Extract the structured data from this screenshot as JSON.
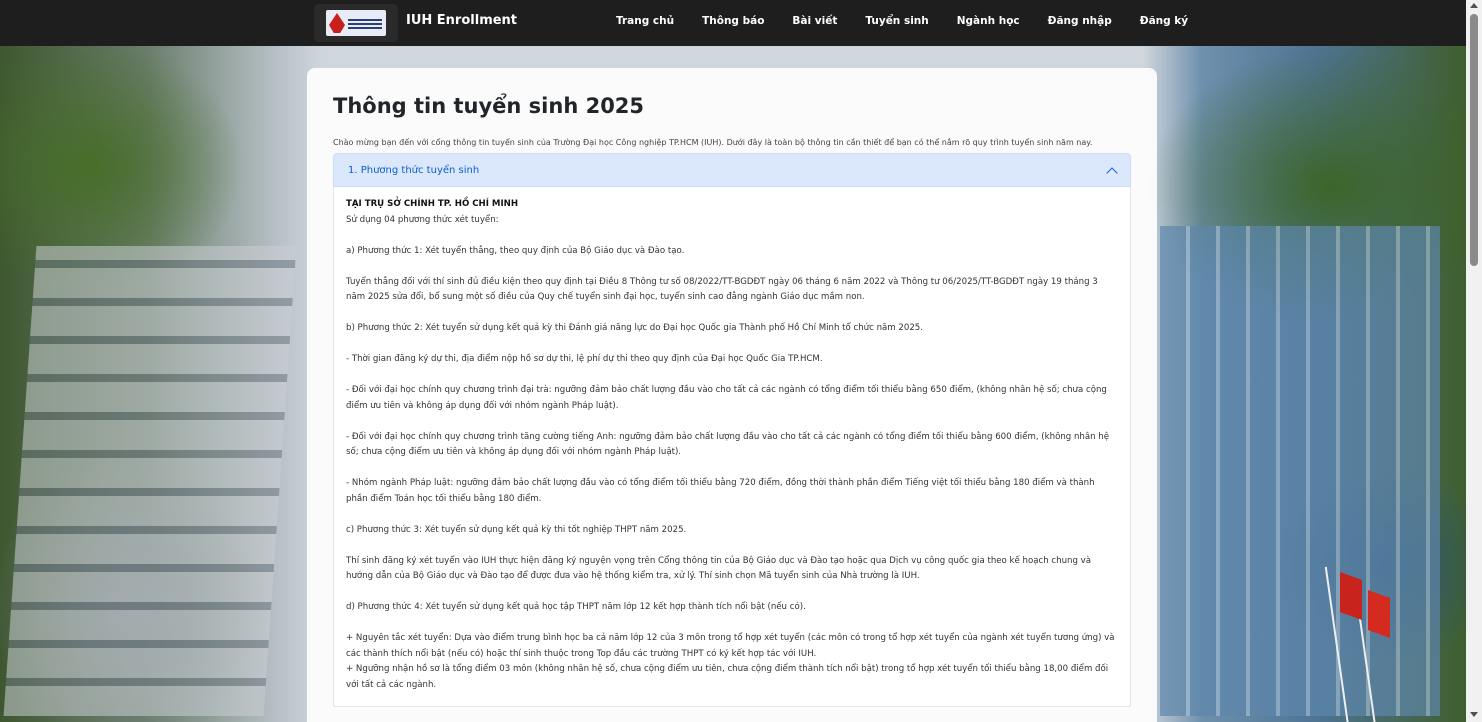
{
  "navbar": {
    "brand": "IUH Enrollment",
    "links": [
      "Trang chủ",
      "Thông báo",
      "Bài viết",
      "Tuyển sinh",
      "Ngành học",
      "Đăng nhập",
      "Đăng ký"
    ]
  },
  "page": {
    "title": "Thông tin tuyển sinh 2025",
    "intro": "Chào mừng bạn đến với cổng thông tin tuyển sinh của Trường Đại học Công nghiệp TP.HCM (IUH). Dưới đây là toàn bộ thông tin cần thiết để bạn có thể nắm rõ quy trình tuyển sinh năm nay."
  },
  "accordion": {
    "header": "1. Phương thức tuyển sinh",
    "paragraphs": [
      "TẠI TRỤ SỞ CHÍNH TP. HỒ CHÍ MINH",
      "Sử dụng 04 phương thức xét tuyển:",
      "a) Phương thức 1: Xét tuyển thẳng, theo quy định của Bộ Giáo dục và Đào tạo.",
      "Tuyển thẳng đối với thí sinh đủ điều kiện theo quy định tại Điều 8 Thông tư số 08/2022/TT-BGDĐT ngày 06 tháng 6 năm 2022 và Thông tư 06/2025/TT-BGDĐT ngày 19 tháng 3 năm 2025 sửa đổi, bổ sung một số điều của Quy chế tuyển sinh đại học, tuyển sinh cao đẳng ngành Giáo dục mầm non.",
      "b) Phương thức 2: Xét tuyển sử dụng kết quả kỳ thi Đánh giá năng lực do Đại học Quốc gia Thành phố Hồ Chí Minh tổ chức năm 2025.",
      "- Thời gian đăng ký dự thi, địa điểm nộp hồ sơ dự thi, lệ phí dự thi theo quy định của Đại học Quốc Gia TP.HCM.",
      "- Đối với đại học chính quy chương trình đại trà: ngưỡng đảm bảo chất lượng đầu vào cho tất cả các ngành có tổng điểm tối thiểu bằng 650 điểm, (không nhân hệ số; chưa cộng điểm ưu tiên và không áp dụng đối với nhóm ngành Pháp luật).",
      "- Đối với đại học chính quy chương trình tăng cường tiếng Anh: ngưỡng đảm bảo chất lượng đầu vào cho tất cả các ngành có tổng điểm tối thiểu bằng 600 điểm, (không nhân hệ số; chưa cộng điểm ưu tiên và không áp dụng đối với nhóm ngành Pháp luật).",
      "- Nhóm ngành Pháp luật: ngưỡng đảm bảo chất lượng đầu vào có tổng điểm tối thiểu bằng 720 điểm, đồng thời thành phần điểm Tiếng việt tối thiểu bằng 180 điểm và thành phần điểm Toán học tối thiểu bằng 180 điểm.",
      "c) Phương thức 3: Xét tuyển sử dụng kết quả kỳ thi tốt nghiệp THPT năm 2025.",
      "Thí sinh đăng ký xét tuyển vào IUH thực hiện đăng ký nguyện vọng trên Cổng thông tin của Bộ Giáo dục và Đào tạo hoặc qua Dịch vụ công quốc gia theo kế hoạch chung và hướng dẫn của Bộ Giáo dục và Đào tạo để được đưa vào hệ thống kiểm tra, xử lý. Thí sinh chọn Mã tuyển sinh của Nhà trường là IUH.",
      "d) Phương thức 4: Xét tuyển sử dụng kết quả học tập THPT năm lớp 12 kết hợp thành tích nổi bật (nếu có).",
      "+ Nguyên tắc xét tuyển: Dựa vào điểm trung bình học ba cả năm lớp 12 của 3 môn trong tổ hợp xét tuyển (các môn có trong tổ hợp xét tuyển của ngành xét tuyển tương ứng) và các thành thích nổi bật (nếu có) hoặc thí sinh thuộc trong Top đầu các trường THPT có ký kết hợp tác với IUH.",
      "+ Ngưỡng nhận hồ sơ là tổng điểm 03 môn (không nhân hệ số, chưa cộng điểm ưu tiên, chưa cộng điểm thành tích nổi bật) trong tổ hợp xét tuyển tối thiểu bằng 18,00 điểm đối với tất cả các ngành."
    ]
  }
}
